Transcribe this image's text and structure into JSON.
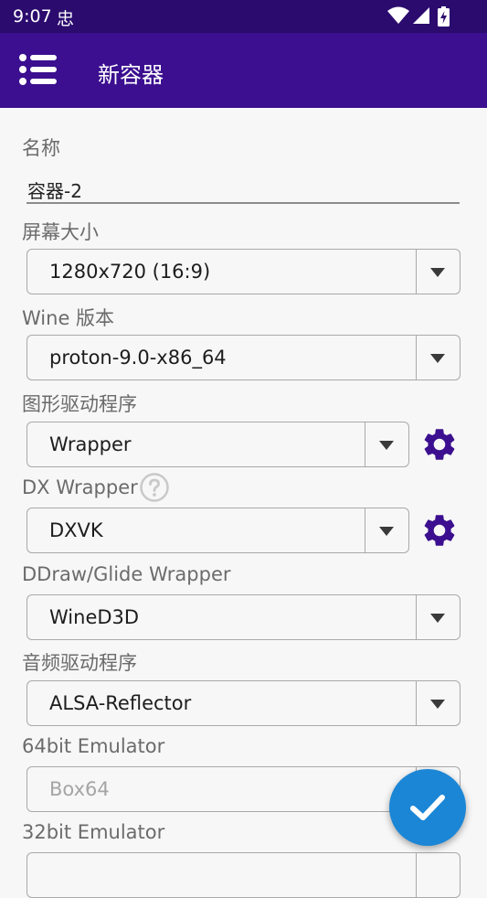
{
  "status_bar": {
    "time": "9:07",
    "notification_glyph": "忠",
    "icons": [
      "wifi-icon",
      "signal-icon",
      "battery-charging-icon"
    ]
  },
  "app_bar": {
    "title": "新容器",
    "menu_icon": "menu-list-icon",
    "background": "#3b0f8f"
  },
  "form": {
    "name": {
      "label": "名称",
      "value": "容器-2"
    },
    "screen_size": {
      "label": "屏幕大小",
      "value": "1280x720 (16:9)"
    },
    "wine_version": {
      "label": "Wine 版本",
      "value": "proton-9.0-x86_64"
    },
    "graphics_driver": {
      "label": "图形驱动程序",
      "value": "Wrapper",
      "settings_icon": "gear-icon"
    },
    "dx_wrapper": {
      "label": "DX Wrapper",
      "value": "DXVK",
      "help_icon": "help-icon",
      "settings_icon": "gear-icon"
    },
    "ddraw_wrapper": {
      "label": "DDraw/Glide Wrapper",
      "value": "WineD3D"
    },
    "audio_driver": {
      "label": "音频驱动程序",
      "value": "ALSA-Reflector"
    },
    "emulator_64": {
      "label": "64bit Emulator",
      "value": "Box64"
    },
    "emulator_32": {
      "label": "32bit Emulator",
      "value": ""
    }
  },
  "fab": {
    "icon": "checkmark-icon",
    "color": "#1b86d6"
  },
  "colors": {
    "accent_icon": "#3b0f8f"
  }
}
